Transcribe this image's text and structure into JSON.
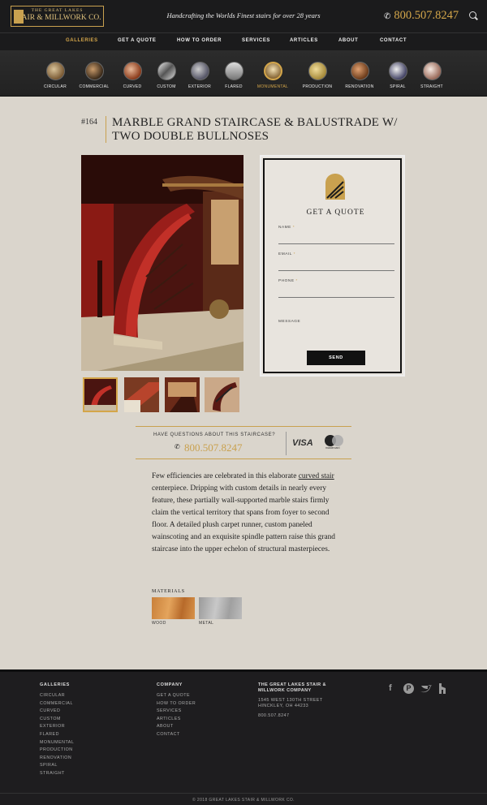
{
  "header": {
    "logo_line1": "THE GREAT LAKES",
    "logo_line2": "STAIR & MILLWORK CO.",
    "tagline": "Handcrafting the Worlds Finest stairs for over 28 years",
    "phone": "800.507.8247"
  },
  "nav": [
    "GALLERIES",
    "GET A QUOTE",
    "HOW TO ORDER",
    "SERVICES",
    "ARTICLES",
    "ABOUT",
    "CONTACT"
  ],
  "gallery": [
    "CIRCULAR",
    "COMMERCIAL",
    "CURVED",
    "CUSTOM",
    "EXTERIOR",
    "FLARED",
    "MONUMENTAL",
    "PRODUCTION",
    "RENOVATION",
    "SPIRAL",
    "STRAIGHT"
  ],
  "product": {
    "ref": "#164",
    "title": "MARBLE GRAND STAIRCASE & BALUSTRADE W/ TWO DOUBLE BULLNOSES"
  },
  "quote_form": {
    "title": "GET A QUOTE",
    "name_label": "NAME",
    "email_label": "EMAIL",
    "phone_label": "PHONE",
    "message_label": "MESSAGE",
    "required": "*",
    "send": "SEND"
  },
  "questions": {
    "text": "HAVE QUESTIONS ABOUT THIS STAIRCASE?",
    "phone": "800.507.8247",
    "visa": "VISA",
    "mastercard": "mastercard"
  },
  "description": {
    "before": "Few efficiencies are celebrated in this elaborate ",
    "link": "curved stair",
    "after": " centerpiece. Dripping with custom details in nearly every feature, these partially wall-supported marble stairs firmly claim the vertical territory that spans from foyer to second floor. A detailed plush carpet runner, custom paneled wainscoting and an exquisite spindle pattern raise this grand staircase into the upper echelon of structural masterpieces."
  },
  "materials": {
    "heading": "MATERIALS",
    "items": [
      "WOOD",
      "METAL"
    ]
  },
  "footer": {
    "galleries_head": "GALLERIES",
    "galleries": [
      "CIRCULAR",
      "COMMERCIAL",
      "CURVED",
      "CUSTOM",
      "EXTERIOR",
      "FLARED",
      "MONUMENTAL",
      "PRODUCTION",
      "RENOVATION",
      "SPIRAL",
      "STRAIGHT"
    ],
    "company_head": "COMPANY",
    "company": [
      "GET A QUOTE",
      "HOW TO ORDER",
      "SERVICES",
      "ARTICLES",
      "ABOUT",
      "CONTACT"
    ],
    "company_name1": "THE GREAT LAKES STAIR &",
    "company_name2": "MILLWORK COMPANY",
    "address1": "1545 WEST 130TH STREET",
    "address2": "HINCKLEY, OH 44233",
    "phone": "800.507.8247",
    "copyright": "© 2018 GREAT LAKES STAIR & MILLWORK CO."
  },
  "colors": {
    "accent": "#d4a64a",
    "dark": "#1b1b1c",
    "bg": "#dad5cc"
  },
  "icons": [
    "phone-icon",
    "search-icon",
    "facebook-icon",
    "pinterest-icon",
    "twitter-icon",
    "houzz-icon"
  ]
}
